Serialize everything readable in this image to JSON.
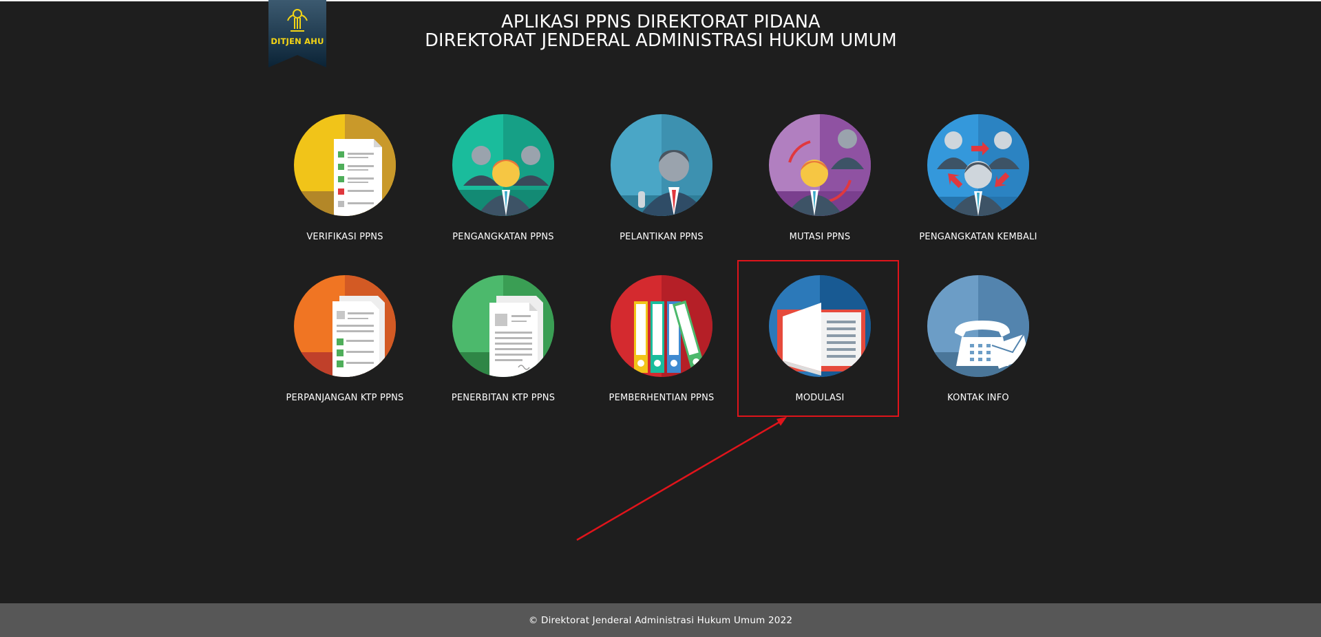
{
  "logo": {
    "text": "DITJEN AHU"
  },
  "header": {
    "line1": "APLIKASI PPNS DIREKTORAT PIDANA",
    "line2": "DIREKTORAT JENDERAL ADMINISTRASI HUKUM UMUM"
  },
  "menu": [
    {
      "label": "VERIFIKASI PPNS",
      "icon": "checklist-document-icon",
      "color": "#f1c419"
    },
    {
      "label": "PENGANGKATAN PPNS",
      "icon": "people-appointment-icon",
      "color": "#1abc9c"
    },
    {
      "label": "PELANTIKAN PPNS",
      "icon": "oath-person-icon",
      "color": "#4aa6c6"
    },
    {
      "label": "MUTASI PPNS",
      "icon": "transfer-people-icon",
      "color": "#a56bb7"
    },
    {
      "label": "PENGANGKATAN KEMBALI",
      "icon": "reappointment-people-icon",
      "color": "#3498db"
    },
    {
      "label": "PERPANJANGAN KTP PPNS",
      "icon": "extension-document-icon",
      "color": "#f07523"
    },
    {
      "label": "PENERBITAN KTP PPNS",
      "icon": "issue-document-icon",
      "color": "#43b466"
    },
    {
      "label": "PEMBERHENTIAN PPNS",
      "icon": "binders-icon",
      "color": "#d42a2f"
    },
    {
      "label": "MODULASI",
      "icon": "open-book-icon",
      "color": "#2c79b9"
    },
    {
      "label": "KONTAK INFO",
      "icon": "telephone-mail-icon",
      "color": "#6c9dc6"
    }
  ],
  "highlight_color": "#e0141b",
  "footer": {
    "text": "© Direktorat Jenderal Administrasi Hukum Umum 2022"
  }
}
